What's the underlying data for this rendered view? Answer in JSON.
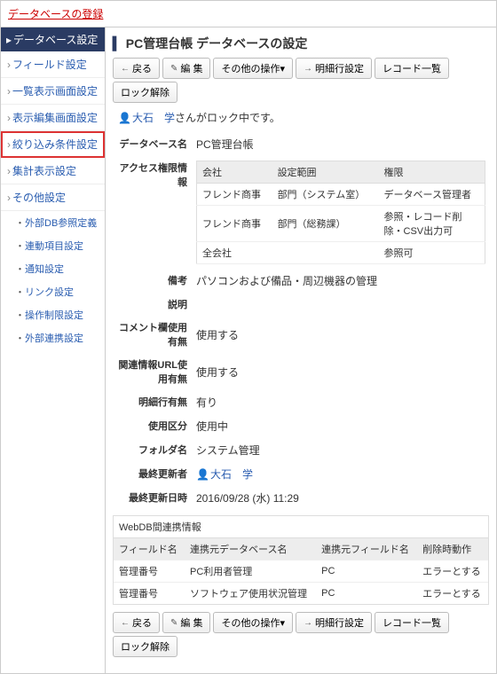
{
  "topLink": "データベースの登録",
  "sidebar": {
    "header": "データベース設定",
    "items": [
      {
        "label": "フィールド設定"
      },
      {
        "label": "一覧表示画面設定"
      },
      {
        "label": "表示編集画面設定"
      },
      {
        "label": "絞り込み条件設定",
        "selected": true
      },
      {
        "label": "集計表示設定"
      },
      {
        "label": "その他設定",
        "sub": [
          "外部DB参照定義",
          "連動項目設定",
          "通知設定",
          "リンク設定",
          "操作制限設定",
          "外部連携設定"
        ]
      }
    ]
  },
  "title": "PC管理台帳 データベースの設定",
  "toolbar": {
    "back": "戻る",
    "edit": "編 集",
    "other": "その他の操作▾",
    "detail": "明細行設定",
    "list": "レコード一覧",
    "unlock": "ロック解除"
  },
  "lock": {
    "user": "大石　学",
    "suffix": "さんがロック中です。"
  },
  "rows": {
    "dbname": {
      "label": "データベース名",
      "value": "PC管理台帳"
    },
    "access": {
      "label": "アクセス権限情報",
      "head": {
        "c1": "会社",
        "c2": "設定範囲",
        "c3": "権限"
      },
      "rows": [
        {
          "c1": "フレンド商事",
          "c2": "部門（システム室）",
          "c3": "データベース管理者"
        },
        {
          "c1": "フレンド商事",
          "c2": "部門（総務課）",
          "c3": "参照・レコード削除・CSV出力可"
        },
        {
          "c1": "全会社",
          "c2": "",
          "c3": "参照可"
        }
      ]
    },
    "memo": {
      "label": "備考",
      "value": "パソコンおよび備品・周辺機器の管理"
    },
    "desc": {
      "label": "説明",
      "value": ""
    },
    "comment": {
      "label": "コメント欄使用有無",
      "value": "使用する"
    },
    "relurl": {
      "label": "関連情報URL使用有無",
      "value": "使用する"
    },
    "detailrow": {
      "label": "明細行有無",
      "value": "有り"
    },
    "usage": {
      "label": "使用区分",
      "value": "使用中"
    },
    "folder": {
      "label": "フォルダ名",
      "value": "システム管理"
    },
    "updater": {
      "label": "最終更新者",
      "value": "大石　学"
    },
    "updated": {
      "label": "最終更新日時",
      "value": "2016/09/28 (水) 11:29"
    }
  },
  "linkage": {
    "title": "WebDB間連携情報",
    "head": {
      "c1": "フィールド名",
      "c2": "連携元データベース名",
      "c3": "連携元フィールド名",
      "c4": "削除時動作"
    },
    "rows": [
      {
        "c1": "管理番号",
        "c2": "PC利用者管理",
        "c3": "PC",
        "c4": "エラーとする"
      },
      {
        "c1": "管理番号",
        "c2": "ソフトウェア使用状況管理",
        "c3": "PC",
        "c4": "エラーとする"
      }
    ]
  }
}
